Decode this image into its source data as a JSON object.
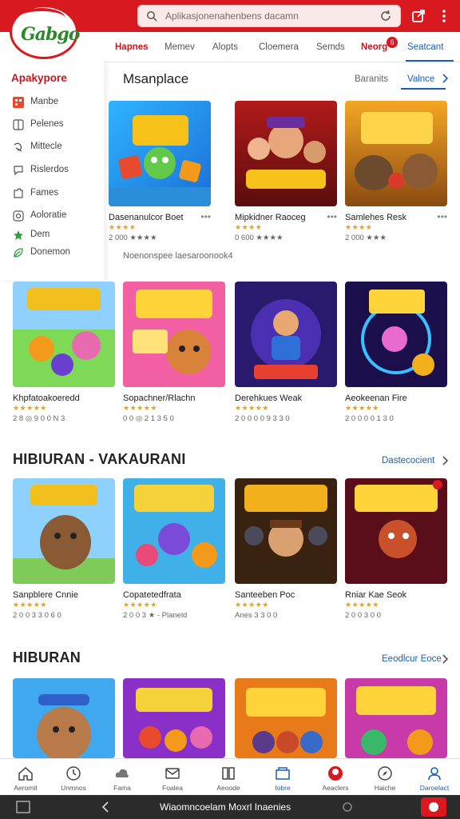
{
  "header": {
    "logo_text": "Gabgo",
    "search_placeholder": "Aplikasjonenahenbens dacamn"
  },
  "tabs": [
    {
      "label": "Hapnes",
      "state": "active"
    },
    {
      "label": "Memev",
      "state": "normal"
    },
    {
      "label": "Alopts",
      "state": "normal"
    },
    {
      "label": "Cloemera",
      "state": "normal"
    },
    {
      "label": "Semds",
      "state": "normal"
    },
    {
      "label": "Neorg",
      "state": "active",
      "badge": "6"
    },
    {
      "label": "Seatcant",
      "state": "selected"
    }
  ],
  "sidebar": {
    "title": "Apakypore",
    "items": [
      {
        "label": "Manbe",
        "icon": "grid-icon"
      },
      {
        "label": "Pelenes",
        "icon": "columns-icon"
      },
      {
        "label": "Mittecle",
        "icon": "swirl-icon"
      },
      {
        "label": "Rislerdos",
        "icon": "speech-icon"
      },
      {
        "label": "Fames",
        "icon": "puzzle-icon"
      },
      {
        "label": "Aoloratie",
        "icon": "compass-icon"
      },
      {
        "label": "Dem",
        "icon": "star-icon"
      },
      {
        "label": "Donemon",
        "icon": "leaf-icon"
      }
    ]
  },
  "section1": {
    "title": "Msanplace",
    "link_gray": "Baranits",
    "link_active": "Valnce",
    "note": "Noenonspee laesaroonook4",
    "cards": [
      {
        "name": "Dasenanulcor Boet",
        "stars": "★★★★",
        "meta": "2 000 ★★★★"
      },
      {
        "name": "Mipkidner Raoceg",
        "stars": "★★★★",
        "meta": "0 600 ★★★★"
      },
      {
        "name": "Samlehes Resk",
        "stars": "★★★★",
        "meta": "2 000 ★★★"
      }
    ]
  },
  "section2": {
    "cards": [
      {
        "name": "Khpfatoakoeredd",
        "stars": "★★★★★",
        "meta": "2 8 ◎ 9 0 0 N 3"
      },
      {
        "name": "Sopachner/Rlachn",
        "stars": "★★★★★",
        "meta": "0 0 ◎ 2 1 3 5 0"
      },
      {
        "name": "Derehkues Weak",
        "stars": "★★★★★",
        "meta": "2 0 0 0 0 9 3 3 0"
      },
      {
        "name": "Aeokeenan Fire",
        "stars": "★★★★★",
        "meta": "2 0 0 0 0 1 3 0"
      }
    ]
  },
  "section3": {
    "title": "HIBIURAN - VAKAURANI",
    "link": "Dastecocient",
    "cards": [
      {
        "name": "Sanpblere Cnnie",
        "stars": "★★★★★",
        "meta": "2 0 0 3 3 0 6 0"
      },
      {
        "name": "Copatetedfrata",
        "stars": "★★★★★",
        "meta": "2 0 0 3 ★ - Planeld"
      },
      {
        "name": "Santeeben Poc",
        "stars": "★★★★★",
        "meta": "Anes 3 3 0 0"
      },
      {
        "name": "Rniar Kae Seok",
        "stars": "★★★★★",
        "meta": "2 0 0 3 0 0"
      }
    ]
  },
  "section4": {
    "title": "HIBURAN",
    "link": "Eeodlcur Eoce",
    "cards": [
      {
        "name": ""
      },
      {
        "name": ""
      },
      {
        "name": ""
      },
      {
        "name": ""
      }
    ]
  },
  "bottom_nav": [
    {
      "label": "Aeromit",
      "icon": "home-icon"
    },
    {
      "label": "Unmnos",
      "icon": "clock-icon"
    },
    {
      "label": "Fama",
      "icon": "cloud-icon"
    },
    {
      "label": "Foalea",
      "icon": "mail-icon"
    },
    {
      "label": "Aeoode",
      "icon": "book-icon"
    },
    {
      "label": "Iobre",
      "icon": "store-icon"
    },
    {
      "label": "Aeaclers",
      "icon": "avatar-icon"
    },
    {
      "label": "Haiche",
      "icon": "compass2-icon"
    },
    {
      "label": "Daroelact",
      "icon": "person-icon"
    }
  ],
  "system_bar": {
    "title": "Wiaomncoelam Moxrl Inaenies"
  },
  "colors": {
    "brand_red": "#d81920",
    "link_blue": "#1a5fb4",
    "star": "#f2a100"
  }
}
